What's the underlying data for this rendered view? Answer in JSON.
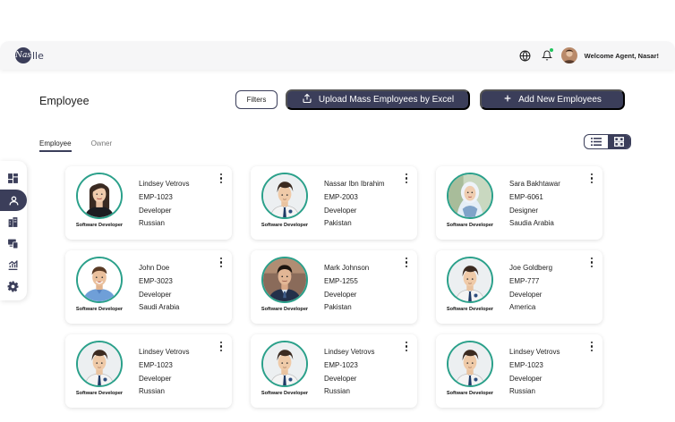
{
  "app": {
    "logo_mark": "Nas",
    "logo_rest": "lle"
  },
  "header": {
    "welcome": "Welcome Agent, Nasar!"
  },
  "page": {
    "title": "Employee",
    "filters_label": "Filters",
    "upload_label": "Upload Mass Employees by Excel",
    "add_label": "Add New Employees"
  },
  "tabs": [
    {
      "label": "Employee",
      "active": true
    },
    {
      "label": "Owner",
      "active": false
    }
  ],
  "sidebar": {
    "items": [
      {
        "icon": "dashboard-icon"
      },
      {
        "icon": "user-icon",
        "active": true
      },
      {
        "icon": "building-icon"
      },
      {
        "icon": "devices-icon"
      },
      {
        "icon": "chart-icon"
      },
      {
        "icon": "gear-icon"
      }
    ]
  },
  "employees": [
    {
      "name": "Lindsey Vetrovs",
      "id": "EMP-1023",
      "role": "Developer",
      "country": "Russian",
      "caption": "Software Developer",
      "avatar": "woman-dark-hair"
    },
    {
      "name": "Nassar Ibn Ibrahim",
      "id": "EMP-2003",
      "role": "Developer",
      "country": "Pakistan",
      "caption": "Software Developer",
      "avatar": "cartoon-man"
    },
    {
      "name": "Sara Bakhtawar",
      "id": "EMP-6061",
      "role": "Designer",
      "country": "Saudia Arabia",
      "caption": "Software Developer",
      "avatar": "woman-hijab"
    },
    {
      "name": "John Doe",
      "id": "EMP-3023",
      "role": "Developer",
      "country": "Saudi Arabia",
      "caption": "Software Developer",
      "avatar": "man-blue-shirt"
    },
    {
      "name": "Mark Johnson",
      "id": "EMP-1255",
      "role": "Developer",
      "country": "Pakistan",
      "caption": "Software Developer",
      "avatar": "man-suit"
    },
    {
      "name": "Joe Goldberg",
      "id": "EMP-777",
      "role": "Developer",
      "country": "America",
      "caption": "Software Developer",
      "avatar": "cartoon-man"
    },
    {
      "name": "Lindsey Vetrovs",
      "id": "EMP-1023",
      "role": "Developer",
      "country": "Russian",
      "caption": "Software Developer",
      "avatar": "cartoon-man"
    },
    {
      "name": "Lindsey Vetrovs",
      "id": "EMP-1023",
      "role": "Developer",
      "country": "Russian",
      "caption": "Software Developer",
      "avatar": "cartoon-man"
    },
    {
      "name": "Lindsey Vetrovs",
      "id": "EMP-1023",
      "role": "Developer",
      "country": "Russian",
      "caption": "Software Developer",
      "avatar": "cartoon-man"
    }
  ],
  "colors": {
    "primary": "#3b3e5a",
    "avatar_ring": "#2aa08a",
    "online": "#22c55e"
  }
}
